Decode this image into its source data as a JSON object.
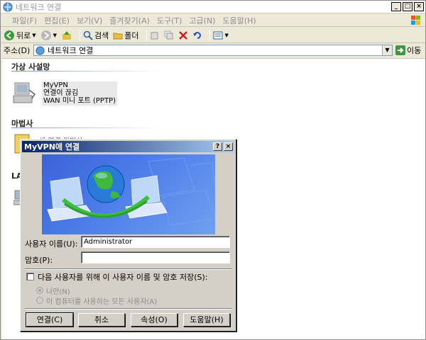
{
  "window": {
    "title": "네트워크 연결",
    "controls": [
      "_",
      "□",
      "×"
    ]
  },
  "menubar": {
    "items": [
      "파일(F)",
      "편집(E)",
      "보기(V)",
      "즐겨찾기(A)",
      "도구(T)",
      "고급(N)",
      "도움말(H)"
    ]
  },
  "toolbar": {
    "back_label": "뒤로",
    "search_label": "검색",
    "folders_label": "폴더"
  },
  "addressbar": {
    "label": "주소(D)",
    "value": "네트워크 연결",
    "go_label": "이동"
  },
  "content": {
    "group_vpn": "가상 사설망",
    "vpn_item": {
      "name": "MyVPN",
      "status": "연결이 끊김",
      "device": "WAN 미니 포트 (PPTP)"
    },
    "group_wizard": "마법사",
    "wizard_item_partial": "새 연결 마법사",
    "group_lan_partial": "LA"
  },
  "dialog": {
    "title": "MyVPN에 연결",
    "help_btn": "?",
    "close_btn": "×",
    "username_label": "사용자 이름(U):",
    "username_value": "Administrator",
    "password_label": "암호(P):",
    "password_value": "",
    "save_checkbox_label": "다음 사용자를 위해 이 사용자 이름 및 암호 저장(S):",
    "radio_me_only": "나만(N)",
    "radio_anyone": "이 컴퓨터를 사용하는 모든 사용자(A)",
    "buttons": {
      "connect": "연결(C)",
      "cancel": "취소",
      "properties": "속성(O)",
      "help": "도움말(H)"
    }
  },
  "colors": {
    "title_gradient_start": "#0a246a",
    "title_gradient_end": "#a6caf0",
    "banner_blue": "#3b62d8",
    "group_line": "#7a96df"
  }
}
